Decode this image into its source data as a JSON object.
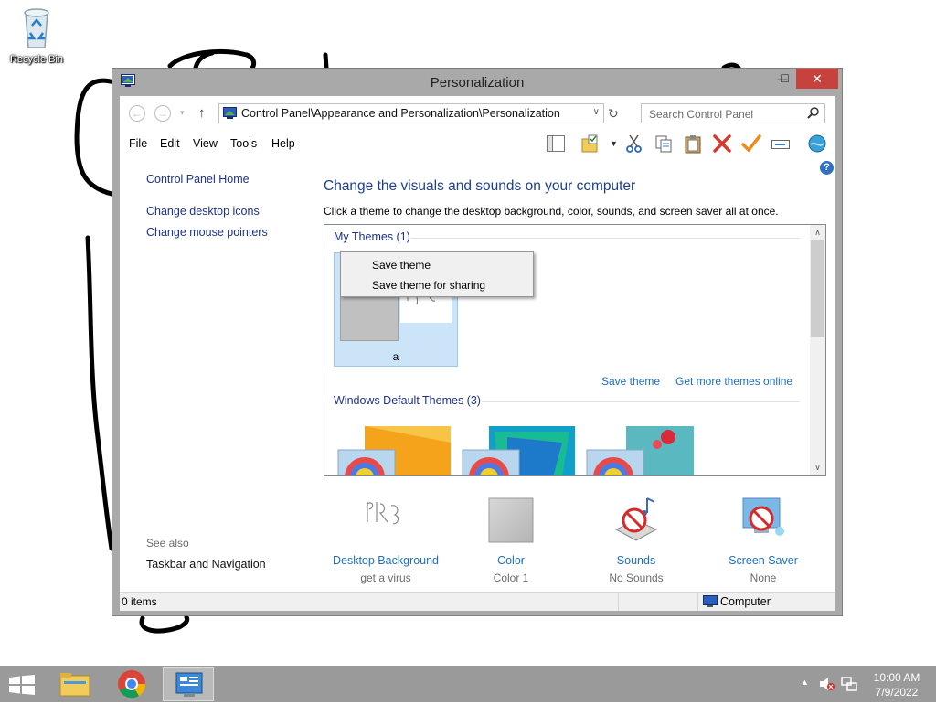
{
  "desktop": {
    "icons": [
      {
        "label": "Recycle Bin",
        "icon": "recycle-bin-icon"
      }
    ]
  },
  "window": {
    "title": "Personalization",
    "controls": {
      "minimize": "—",
      "maximize": "☐",
      "close": "✕"
    },
    "address": {
      "path": "Control Panel\\Appearance and Personalization\\Personalization"
    },
    "search": {
      "placeholder": "Search Control Panel"
    },
    "menu": [
      "File",
      "Edit",
      "View",
      "Tools",
      "Help"
    ],
    "left_pane": {
      "links": [
        "Control Panel Home",
        "Change desktop icons",
        "Change mouse pointers"
      ],
      "see_also_label": "See also",
      "see_also_links": [
        "Taskbar and Navigation"
      ]
    },
    "main": {
      "heading": "Change the visuals and sounds on your computer",
      "subtitle": "Click a theme to change the desktop background, color, sounds, and screen saver all at once.",
      "my_themes_label": "My Themes (1)",
      "my_theme_name": "a",
      "save_theme_link": "Save theme",
      "get_more_link": "Get more themes online",
      "default_themes_label": "Windows Default Themes (3)"
    },
    "context_menu": [
      "Save theme",
      "Save theme for sharing"
    ],
    "settings": [
      {
        "name": "Desktop Background",
        "value": "get a virus",
        "icon": "desktop-background-icon"
      },
      {
        "name": "Color",
        "value": "Color 1",
        "icon": "color-swatch-icon"
      },
      {
        "name": "Sounds",
        "value": "No Sounds",
        "icon": "sounds-icon"
      },
      {
        "name": "Screen Saver",
        "value": "None",
        "icon": "screen-saver-icon"
      }
    ],
    "status": {
      "items": "0 items",
      "location": "Computer"
    }
  },
  "taskbar": {
    "time": "10:00 AM",
    "date": "7/9/2022"
  },
  "colors": {
    "link": "#1e6fbf",
    "heading": "#1e3f8c",
    "close": "#c7413d",
    "taskbar": "#9a9a9a"
  }
}
